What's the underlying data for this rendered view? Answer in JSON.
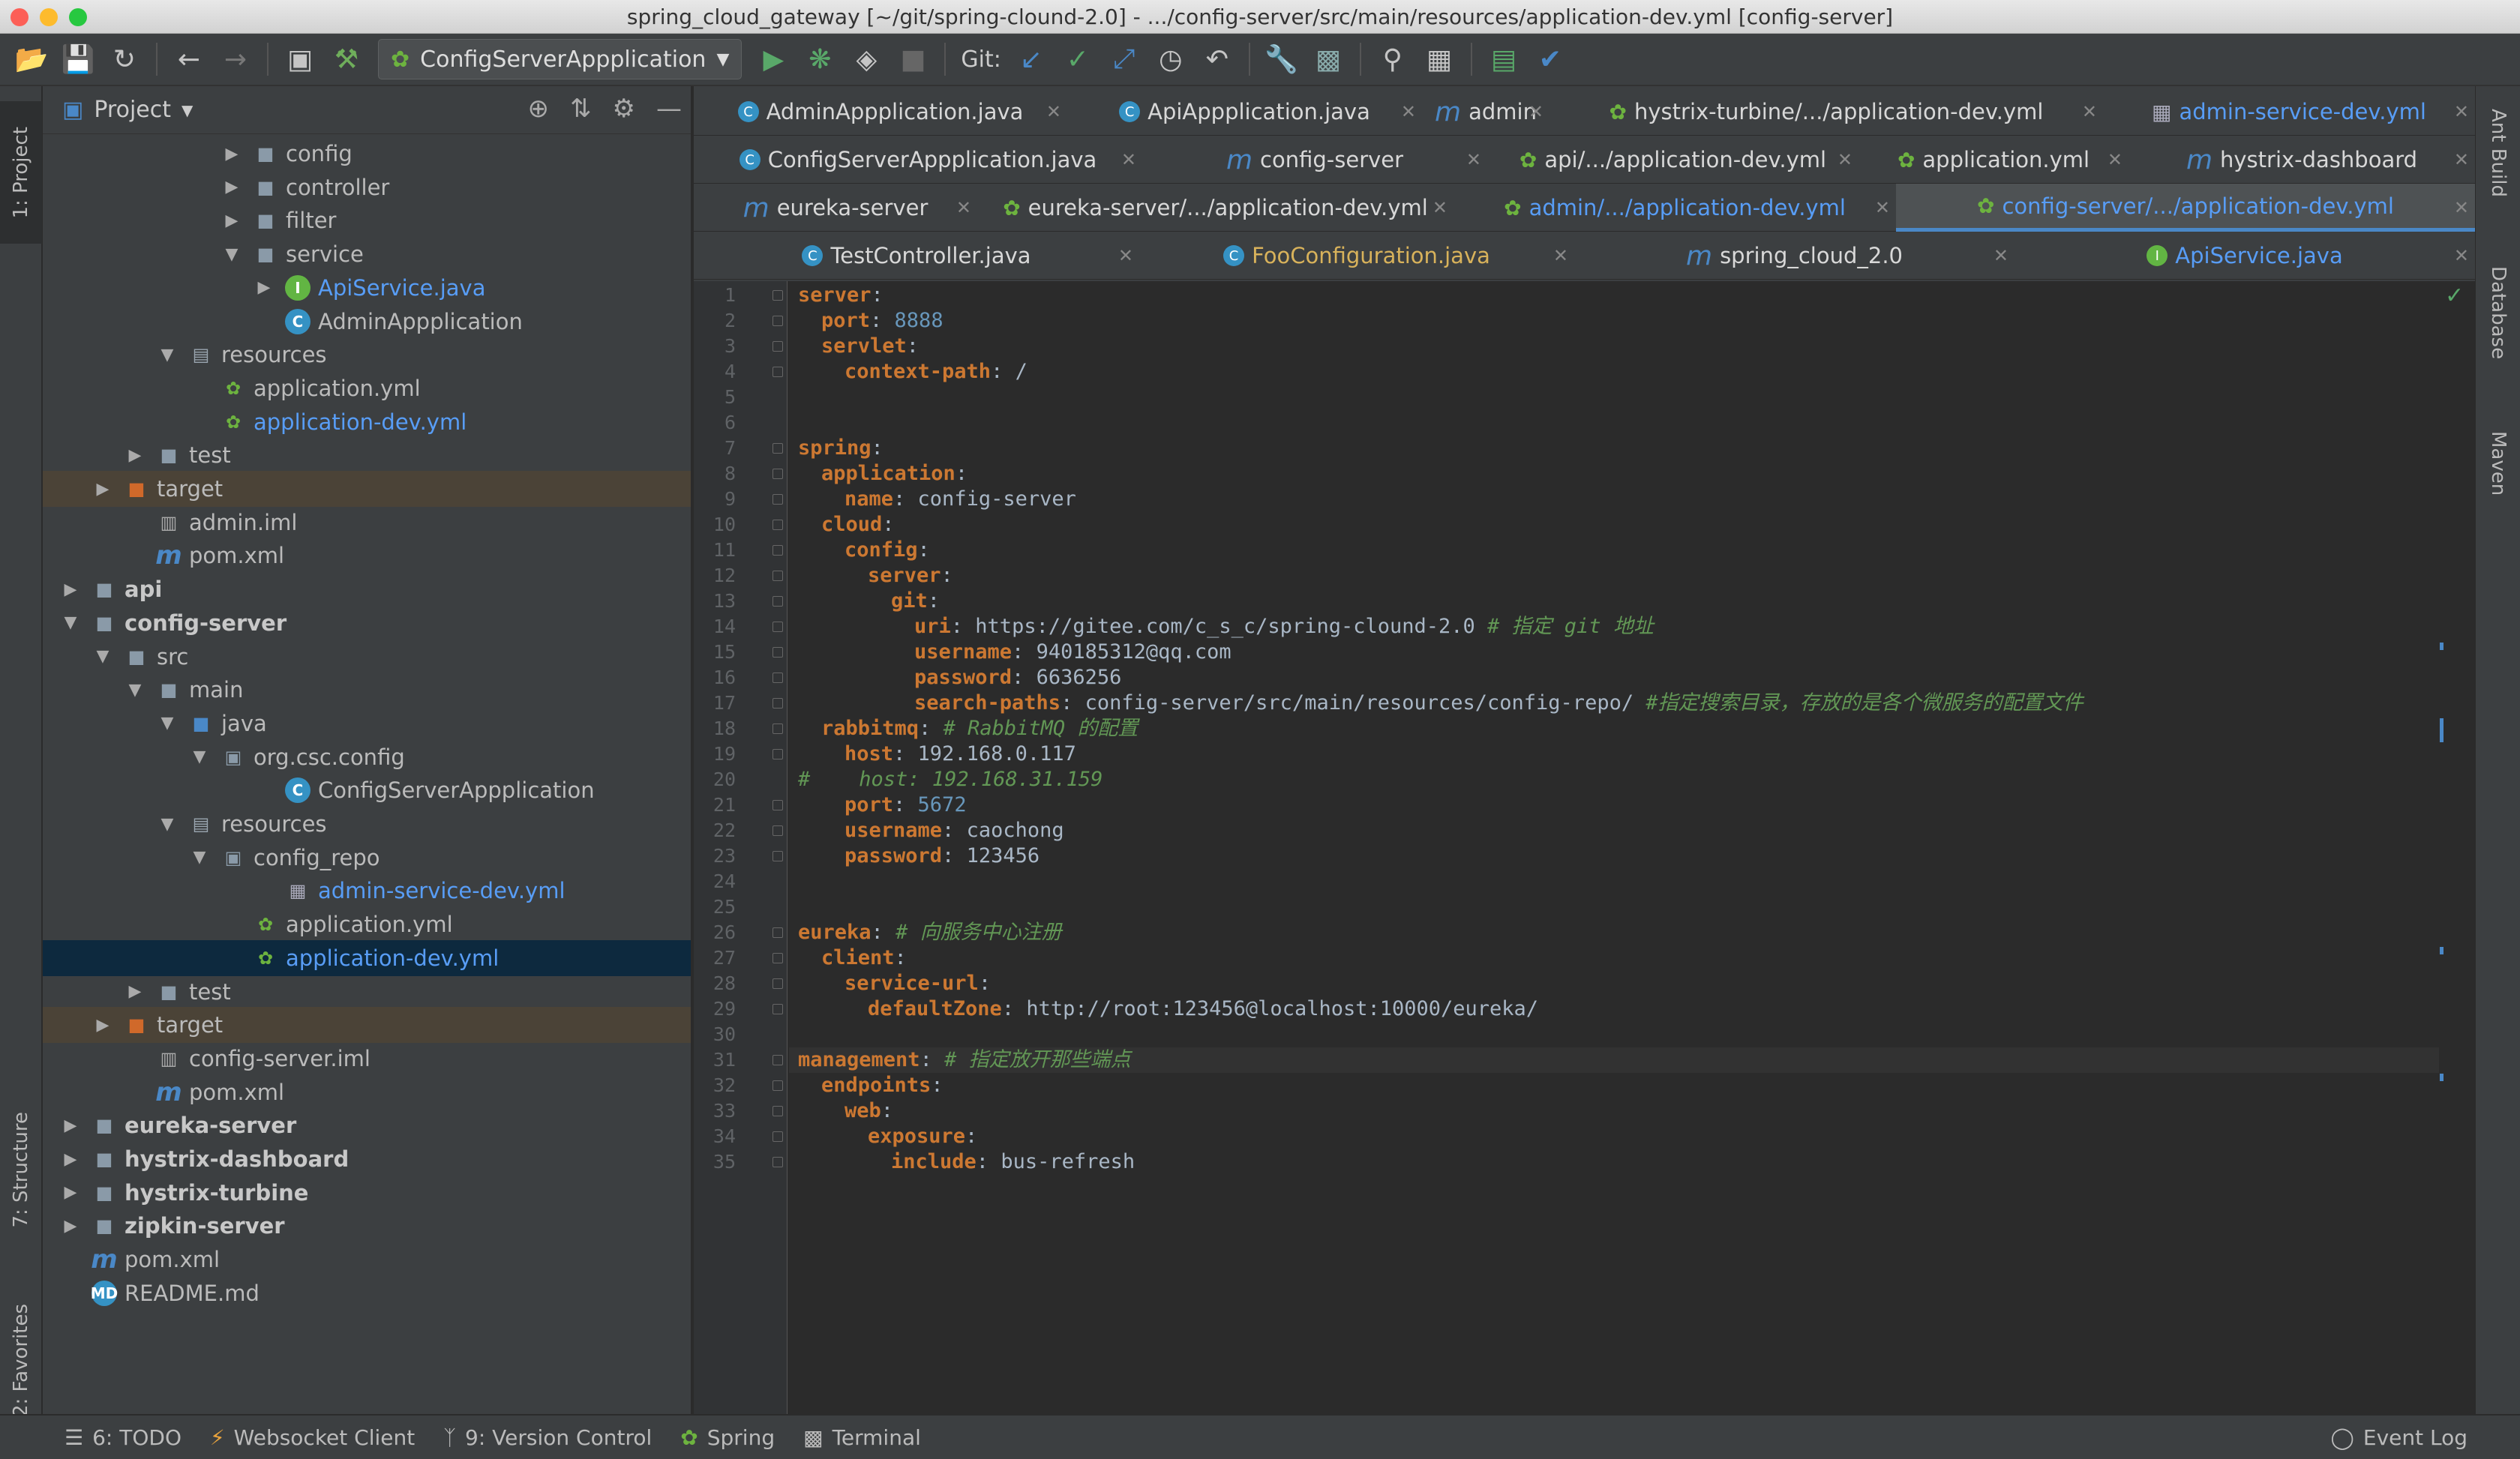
{
  "window": {
    "title": "spring_cloud_gateway [~/git/spring-clound-2.0] - .../config-server/src/main/resources/application-dev.yml [config-server]"
  },
  "toolbar": {
    "run_config": "ConfigServerAppplication",
    "git_label": "Git:"
  },
  "left_strip": {
    "project": "1: Project",
    "structure": "7: Structure",
    "favorites": "2: Favorites"
  },
  "right_strip": {
    "ant": "Ant Build",
    "database": "Database",
    "maven": "Maven"
  },
  "project_panel": {
    "title": "Project",
    "tree": [
      {
        "label": "config",
        "level": 6,
        "type": "folder",
        "arrow": "right"
      },
      {
        "label": "controller",
        "level": 6,
        "type": "folder",
        "arrow": "right"
      },
      {
        "label": "filter",
        "level": 6,
        "type": "folder",
        "arrow": "right"
      },
      {
        "label": "service",
        "level": 6,
        "type": "folder",
        "arrow": "down"
      },
      {
        "label": "ApiService.java",
        "level": 7,
        "type": "interface",
        "arrow": "right",
        "color": "#589df6"
      },
      {
        "label": "AdminAppplication",
        "level": 7,
        "type": "springclass",
        "arrow": ""
      },
      {
        "label": "resources",
        "level": 4,
        "type": "resfolder",
        "arrow": "down"
      },
      {
        "label": "application.yml",
        "level": 5,
        "type": "yml",
        "arrow": ""
      },
      {
        "label": "application-dev.yml",
        "level": 5,
        "type": "yml",
        "arrow": "",
        "color": "#589df6"
      },
      {
        "label": "test",
        "level": 3,
        "type": "folder",
        "arrow": "right"
      },
      {
        "label": "target",
        "level": 2,
        "type": "target",
        "arrow": "right",
        "bg": "#4b4337"
      },
      {
        "label": "admin.iml",
        "level": 3,
        "type": "iml",
        "arrow": ""
      },
      {
        "label": "pom.xml",
        "level": 3,
        "type": "maven",
        "arrow": ""
      },
      {
        "label": "api",
        "level": 1,
        "type": "module",
        "arrow": "right",
        "bold": true
      },
      {
        "label": "config-server",
        "level": 1,
        "type": "module",
        "arrow": "down",
        "bold": true
      },
      {
        "label": "src",
        "level": 2,
        "type": "folder",
        "arrow": "down"
      },
      {
        "label": "main",
        "level": 3,
        "type": "folder",
        "arrow": "down"
      },
      {
        "label": "java",
        "level": 4,
        "type": "srcfolder",
        "arrow": "down"
      },
      {
        "label": "org.csc.config",
        "level": 5,
        "type": "package",
        "arrow": "down"
      },
      {
        "label": "ConfigServerAppplication",
        "level": 7,
        "type": "springclass",
        "arrow": ""
      },
      {
        "label": "resources",
        "level": 4,
        "type": "resfolder",
        "arrow": "down"
      },
      {
        "label": "config_repo",
        "level": 5,
        "type": "package",
        "arrow": "down"
      },
      {
        "label": "admin-service-dev.yml",
        "level": 7,
        "type": "table",
        "arrow": "",
        "color": "#589df6"
      },
      {
        "label": "application.yml",
        "level": 6,
        "type": "yml",
        "arrow": ""
      },
      {
        "label": "application-dev.yml",
        "level": 6,
        "type": "yml",
        "arrow": "",
        "color": "#589df6",
        "selected": true
      },
      {
        "label": "test",
        "level": 3,
        "type": "folder",
        "arrow": "right"
      },
      {
        "label": "target",
        "level": 2,
        "type": "target",
        "arrow": "right",
        "bg": "#4b4337"
      },
      {
        "label": "config-server.iml",
        "level": 3,
        "type": "iml",
        "arrow": ""
      },
      {
        "label": "pom.xml",
        "level": 3,
        "type": "maven",
        "arrow": ""
      },
      {
        "label": "eureka-server",
        "level": 1,
        "type": "module",
        "arrow": "right",
        "bold": true
      },
      {
        "label": "hystrix-dashboard",
        "level": 1,
        "type": "module",
        "arrow": "right",
        "bold": true
      },
      {
        "label": "hystrix-turbine",
        "level": 1,
        "type": "module",
        "arrow": "right",
        "bold": true
      },
      {
        "label": "zipkin-server",
        "level": 1,
        "type": "module",
        "arrow": "right",
        "bold": true
      },
      {
        "label": "pom.xml",
        "level": 1,
        "type": "maven",
        "arrow": ""
      },
      {
        "label": "README.md",
        "level": 1,
        "type": "md",
        "arrow": ""
      }
    ]
  },
  "editor_tabs": [
    [
      {
        "label": "AdminAppplication.java",
        "icon": "spring"
      },
      {
        "label": "ApiAppplication.java",
        "icon": "spring"
      },
      {
        "label": "admin",
        "icon": "m"
      },
      {
        "label": "hystrix-turbine/.../application-dev.yml",
        "icon": "yml"
      },
      {
        "label": "admin-service-dev.yml",
        "icon": "table",
        "color": "#589df6"
      }
    ],
    [
      {
        "label": "ConfigServerAppplication.java",
        "icon": "spring"
      },
      {
        "label": "config-server",
        "icon": "m"
      },
      {
        "label": "api/.../application-dev.yml",
        "icon": "yml"
      },
      {
        "label": "application.yml",
        "icon": "yml"
      },
      {
        "label": "hystrix-dashboard",
        "icon": "m"
      }
    ],
    [
      {
        "label": "eureka-server",
        "icon": "m"
      },
      {
        "label": "eureka-server/.../application-dev.yml",
        "icon": "yml"
      },
      {
        "label": "admin/.../application-dev.yml",
        "icon": "yml",
        "color": "#589df6"
      },
      {
        "label": "config-server/.../application-dev.yml",
        "icon": "yml",
        "color": "#589df6",
        "active": true
      }
    ],
    [
      {
        "label": "TestController.java",
        "icon": "class"
      },
      {
        "label": "FooConfiguration.java",
        "icon": "class",
        "color": "#d8b25b"
      },
      {
        "label": "spring_cloud_2.0",
        "icon": "m"
      },
      {
        "label": "ApiService.java",
        "icon": "interface",
        "color": "#589df6"
      }
    ]
  ],
  "code": [
    {
      "n": "1",
      "i": 0,
      "key": "server",
      "sep": ":",
      "val": "",
      "vt": "",
      "com": ""
    },
    {
      "n": "2",
      "i": 1,
      "key": "port",
      "sep": ": ",
      "val": "8888",
      "vt": "n",
      "com": ""
    },
    {
      "n": "3",
      "i": 1,
      "key": "servlet",
      "sep": ":",
      "val": "",
      "vt": "",
      "com": ""
    },
    {
      "n": "4",
      "i": 2,
      "key": "context-path",
      "sep": ": ",
      "val": "/",
      "vt": "v",
      "com": ""
    },
    {
      "n": "5",
      "i": 0,
      "key": "",
      "sep": "",
      "val": "",
      "vt": "",
      "com": ""
    },
    {
      "n": "6",
      "i": 0,
      "key": "",
      "sep": "",
      "val": "",
      "vt": "",
      "com": ""
    },
    {
      "n": "7",
      "i": 0,
      "key": "spring",
      "sep": ":",
      "val": "",
      "vt": "",
      "com": ""
    },
    {
      "n": "8",
      "i": 1,
      "key": "application",
      "sep": ":",
      "val": "",
      "vt": "",
      "com": ""
    },
    {
      "n": "9",
      "i": 2,
      "key": "name",
      "sep": ": ",
      "val": "config-server",
      "vt": "v",
      "com": ""
    },
    {
      "n": "10",
      "i": 1,
      "key": "cloud",
      "sep": ":",
      "val": "",
      "vt": "",
      "com": ""
    },
    {
      "n": "11",
      "i": 2,
      "key": "config",
      "sep": ":",
      "val": "",
      "vt": "",
      "com": ""
    },
    {
      "n": "12",
      "i": 3,
      "key": "server",
      "sep": ":",
      "val": "",
      "vt": "",
      "com": ""
    },
    {
      "n": "13",
      "i": 4,
      "key": "git",
      "sep": ":",
      "val": "",
      "vt": "",
      "com": ""
    },
    {
      "n": "14",
      "i": 5,
      "key": "uri",
      "sep": ": ",
      "val": "https://gitee.com/c_s_c/spring-clound-2.0",
      "vt": "v",
      "com": " # 指定 git 地址"
    },
    {
      "n": "15",
      "i": 5,
      "key": "username",
      "sep": ": ",
      "val": "940185312@qq.com",
      "vt": "v",
      "com": ""
    },
    {
      "n": "16",
      "i": 5,
      "key": "password",
      "sep": ": ",
      "val": "6636256",
      "vt": "v",
      "com": ""
    },
    {
      "n": "17",
      "i": 5,
      "key": "search-paths",
      "sep": ": ",
      "val": "config-server/src/main/resources/config-repo/",
      "vt": "v",
      "com": " #指定搜索目录，存放的是各个微服务的配置文件"
    },
    {
      "n": "18",
      "i": 1,
      "key": "rabbitmq",
      "sep": ":",
      "val": "",
      "vt": "",
      "com": " # RabbitMQ 的配置"
    },
    {
      "n": "19",
      "i": 2,
      "key": "host",
      "sep": ": ",
      "val": "192.168.0.117",
      "vt": "v",
      "com": ""
    },
    {
      "n": "20",
      "i": 0,
      "key": "",
      "sep": "",
      "val": "",
      "vt": "",
      "com": "#    host: 192.168.31.159"
    },
    {
      "n": "21",
      "i": 2,
      "key": "port",
      "sep": ": ",
      "val": "5672",
      "vt": "n",
      "com": ""
    },
    {
      "n": "22",
      "i": 2,
      "key": "username",
      "sep": ": ",
      "val": "caochong",
      "vt": "v",
      "com": ""
    },
    {
      "n": "23",
      "i": 2,
      "key": "password",
      "sep": ": ",
      "val": "123456",
      "vt": "v",
      "com": ""
    },
    {
      "n": "24",
      "i": 0,
      "key": "",
      "sep": "",
      "val": "",
      "vt": "",
      "com": ""
    },
    {
      "n": "25",
      "i": 0,
      "key": "",
      "sep": "",
      "val": "",
      "vt": "",
      "com": ""
    },
    {
      "n": "26",
      "i": 0,
      "key": "eureka",
      "sep": ":",
      "val": "",
      "vt": "",
      "com": " # 向服务中心注册"
    },
    {
      "n": "27",
      "i": 1,
      "key": "client",
      "sep": ":",
      "val": "",
      "vt": "",
      "com": ""
    },
    {
      "n": "28",
      "i": 2,
      "key": "service-url",
      "sep": ":",
      "val": "",
      "vt": "",
      "com": ""
    },
    {
      "n": "29",
      "i": 3,
      "key": "defaultZone",
      "sep": ": ",
      "val": "http://root:123456@localhost:10000/eureka/",
      "vt": "v",
      "com": ""
    },
    {
      "n": "30",
      "i": 0,
      "key": "",
      "sep": "",
      "val": "",
      "vt": "",
      "com": ""
    },
    {
      "n": "31",
      "i": 0,
      "key": "management",
      "sep": ":",
      "val": "",
      "vt": "",
      "com": " # 指定放开那些端点",
      "hl": true
    },
    {
      "n": "32",
      "i": 1,
      "key": "endpoints",
      "sep": ":",
      "val": "",
      "vt": "",
      "com": ""
    },
    {
      "n": "33",
      "i": 2,
      "key": "web",
      "sep": ":",
      "val": "",
      "vt": "",
      "com": ""
    },
    {
      "n": "34",
      "i": 3,
      "key": "exposure",
      "sep": ":",
      "val": "",
      "vt": "",
      "com": ""
    },
    {
      "n": "35",
      "i": 4,
      "key": "include",
      "sep": ": ",
      "val": "bus-refresh",
      "vt": "v",
      "com": ""
    }
  ],
  "statusbar": {
    "todo": "6: TODO",
    "websocket": "Websocket Client",
    "vcs": "9: Version Control",
    "spring": "Spring",
    "terminal": "Terminal",
    "eventlog": "Event Log"
  },
  "colors": {
    "accent": "#4a88c7",
    "link": "#589df6",
    "keyword": "#cc7832",
    "comment": "#629755",
    "number": "#6897bb"
  }
}
